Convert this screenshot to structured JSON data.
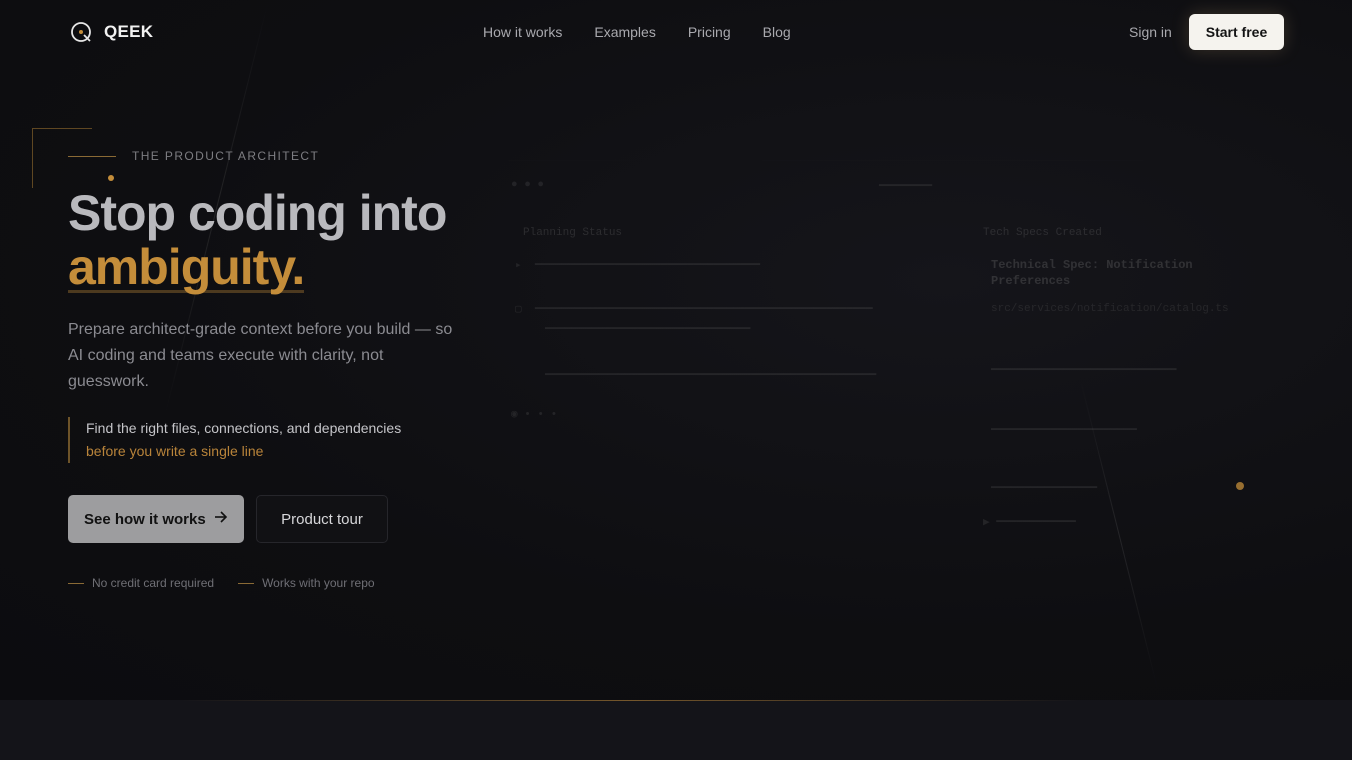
{
  "brand": {
    "name": "QEEK",
    "accent": "#c48d3a"
  },
  "nav": {
    "links": [
      "How it works",
      "Examples",
      "Pricing",
      "Blog"
    ],
    "sign_in": "Sign in",
    "start_free": "Start free"
  },
  "hero": {
    "eyebrow": "THE PRODUCT ARCHITECT",
    "headline_line1": "Stop coding into",
    "headline_line2": "ambiguity.",
    "subtext": "Prepare architect-grade context before you build — so AI coding and teams execute with clarity, not guesswork.",
    "callout_line1": "Find the right files, connections, and dependencies",
    "callout_line2": "before you write a single line",
    "primary_button": "See how it works",
    "secondary_button": "Product tour",
    "notes": [
      "No credit card required",
      "Works with your repo"
    ]
  },
  "preview": {
    "left_title": "Planning Status",
    "right_title": "Tech Specs Created",
    "spec_heading": "Technical Spec: Notification Preferences",
    "spec_path": "src/services/notification/catalog.ts"
  },
  "icons": {
    "logo": "qeek-logo-icon",
    "arrow": "arrow-right-icon"
  }
}
